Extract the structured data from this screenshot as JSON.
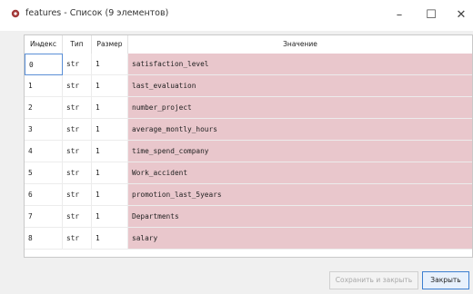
{
  "window": {
    "title": "features - Список (9 элементов)",
    "app_icon": "gear-icon",
    "minimize": "–",
    "maximize": "☐",
    "close": "✕"
  },
  "table": {
    "headers": {
      "index": "Индекс",
      "type": "Тип",
      "size": "Размер",
      "value": "Значение"
    },
    "rows": [
      {
        "index": "0",
        "type": "str",
        "size": "1",
        "value": "satisfaction_level"
      },
      {
        "index": "1",
        "type": "str",
        "size": "1",
        "value": "last_evaluation"
      },
      {
        "index": "2",
        "type": "str",
        "size": "1",
        "value": "number_project"
      },
      {
        "index": "3",
        "type": "str",
        "size": "1",
        "value": "average_montly_hours"
      },
      {
        "index": "4",
        "type": "str",
        "size": "1",
        "value": "time_spend_company"
      },
      {
        "index": "5",
        "type": "str",
        "size": "1",
        "value": "Work_accident"
      },
      {
        "index": "6",
        "type": "str",
        "size": "1",
        "value": "promotion_last_5years"
      },
      {
        "index": "7",
        "type": "str",
        "size": "1",
        "value": "Departments"
      },
      {
        "index": "8",
        "type": "str",
        "size": "1",
        "value": "salary"
      }
    ],
    "value_bg_color": "#e9c7cc"
  },
  "buttons": {
    "save_close": "Сохранить и закрыть",
    "close": "Закрыть"
  }
}
